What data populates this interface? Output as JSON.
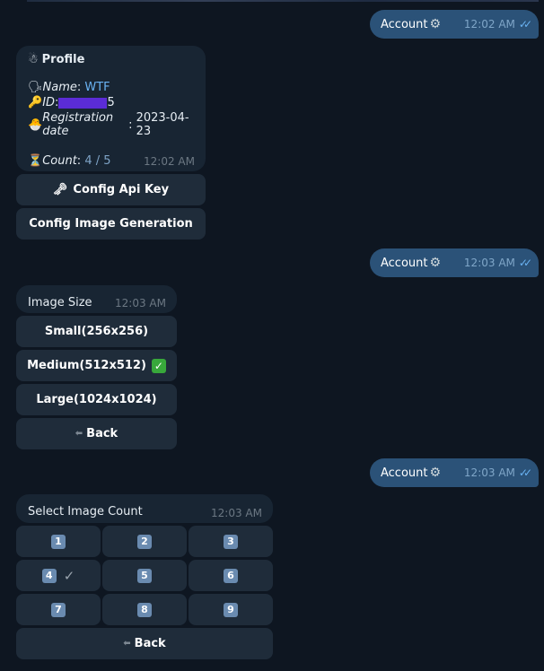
{
  "outgoing": [
    {
      "text": "Account",
      "icon": "gear-icon",
      "time": "12:02 AM"
    },
    {
      "text": "Account",
      "icon": "gear-icon",
      "time": "12:03 AM"
    },
    {
      "text": "Account",
      "icon": "gear-icon",
      "time": "12:03 AM"
    }
  ],
  "profile": {
    "title": "Profile",
    "name_label": "Name",
    "name_value": "WTF",
    "id_label": "ID",
    "id_suffix": "5",
    "reg_label": "Registration date",
    "reg_value": "2023-04-23",
    "count_label": "Count",
    "count_value": "4 / 5",
    "time": "12:02 AM"
  },
  "profile_buttons": {
    "config_api": "Config Api Key",
    "config_image": "Config Image Generation"
  },
  "image_size": {
    "title": "Image Size",
    "time": "12:03 AM",
    "small": "Small(256x256)",
    "medium": "Medium(512x512)",
    "large": "Large(1024x1024)",
    "back": "Back"
  },
  "image_count": {
    "title": "Select Image Count",
    "time": "12:03 AM",
    "numbers": [
      "1",
      "2",
      "3",
      "4",
      "5",
      "6",
      "7",
      "8",
      "9"
    ],
    "selected": "4",
    "back": "Back"
  },
  "colors": {
    "background": "#0e1621",
    "outgoing_bubble": "#2b5278",
    "incoming_bubble": "#182533",
    "button": "#1f2c3a",
    "link": "#6ab3f3"
  }
}
